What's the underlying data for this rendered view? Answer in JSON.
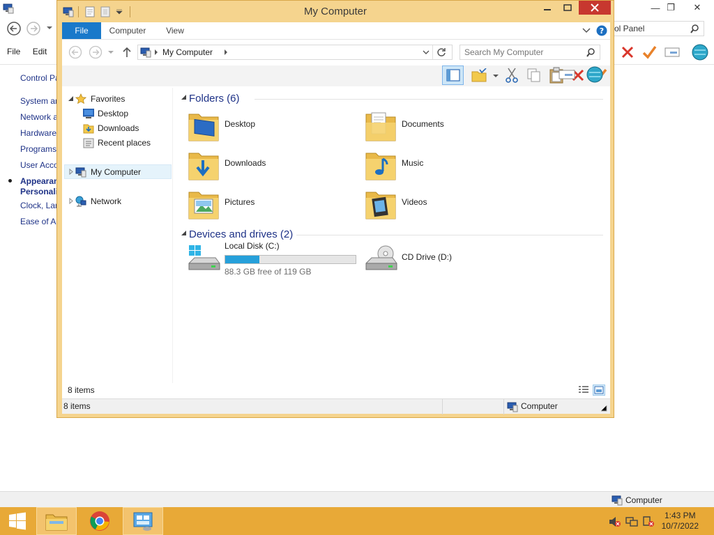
{
  "background_window": {
    "address_text": "rol Panel",
    "menu": [
      "File",
      "Edit"
    ],
    "side_links": [
      "Control Pa",
      "System ar",
      "Network a",
      "Hardware",
      "Programs",
      "User Acco",
      "Appearan",
      "Personaliz",
      "Clock, Lan",
      "Ease of Ac"
    ],
    "status_text": "Computer"
  },
  "window": {
    "title": "My Computer",
    "tabs": {
      "file": "File",
      "computer": "Computer",
      "view": "View"
    },
    "address": {
      "path": "My Computer"
    },
    "search": {
      "placeholder": "Search My Computer"
    }
  },
  "nav_pane": {
    "favorites": "Favorites",
    "desktop": "Desktop",
    "downloads": "Downloads",
    "recent": "Recent places",
    "my_computer": "My Computer",
    "network": "Network"
  },
  "content": {
    "folders_header": "Folders (6)",
    "folders": [
      "Desktop",
      "Documents",
      "Downloads",
      "Music",
      "Pictures",
      "Videos"
    ],
    "drives_header": "Devices and drives (2)",
    "drives": [
      {
        "name": "Local Disk (C:)",
        "free_text": "88.3 GB free of 119 GB",
        "used_fraction": 0.26
      },
      {
        "name": "CD Drive (D:)"
      }
    ]
  },
  "status": {
    "inner_count": "8 items",
    "outer_count": "8 items",
    "location": "Computer"
  },
  "taskbar": {
    "time": "1:43 PM",
    "date": "10/7/2022"
  },
  "colors": {
    "window_frame": "#f5d48e",
    "taskbar": "#e8a937",
    "accent": "#1979ca",
    "progress": "#26a0da"
  }
}
